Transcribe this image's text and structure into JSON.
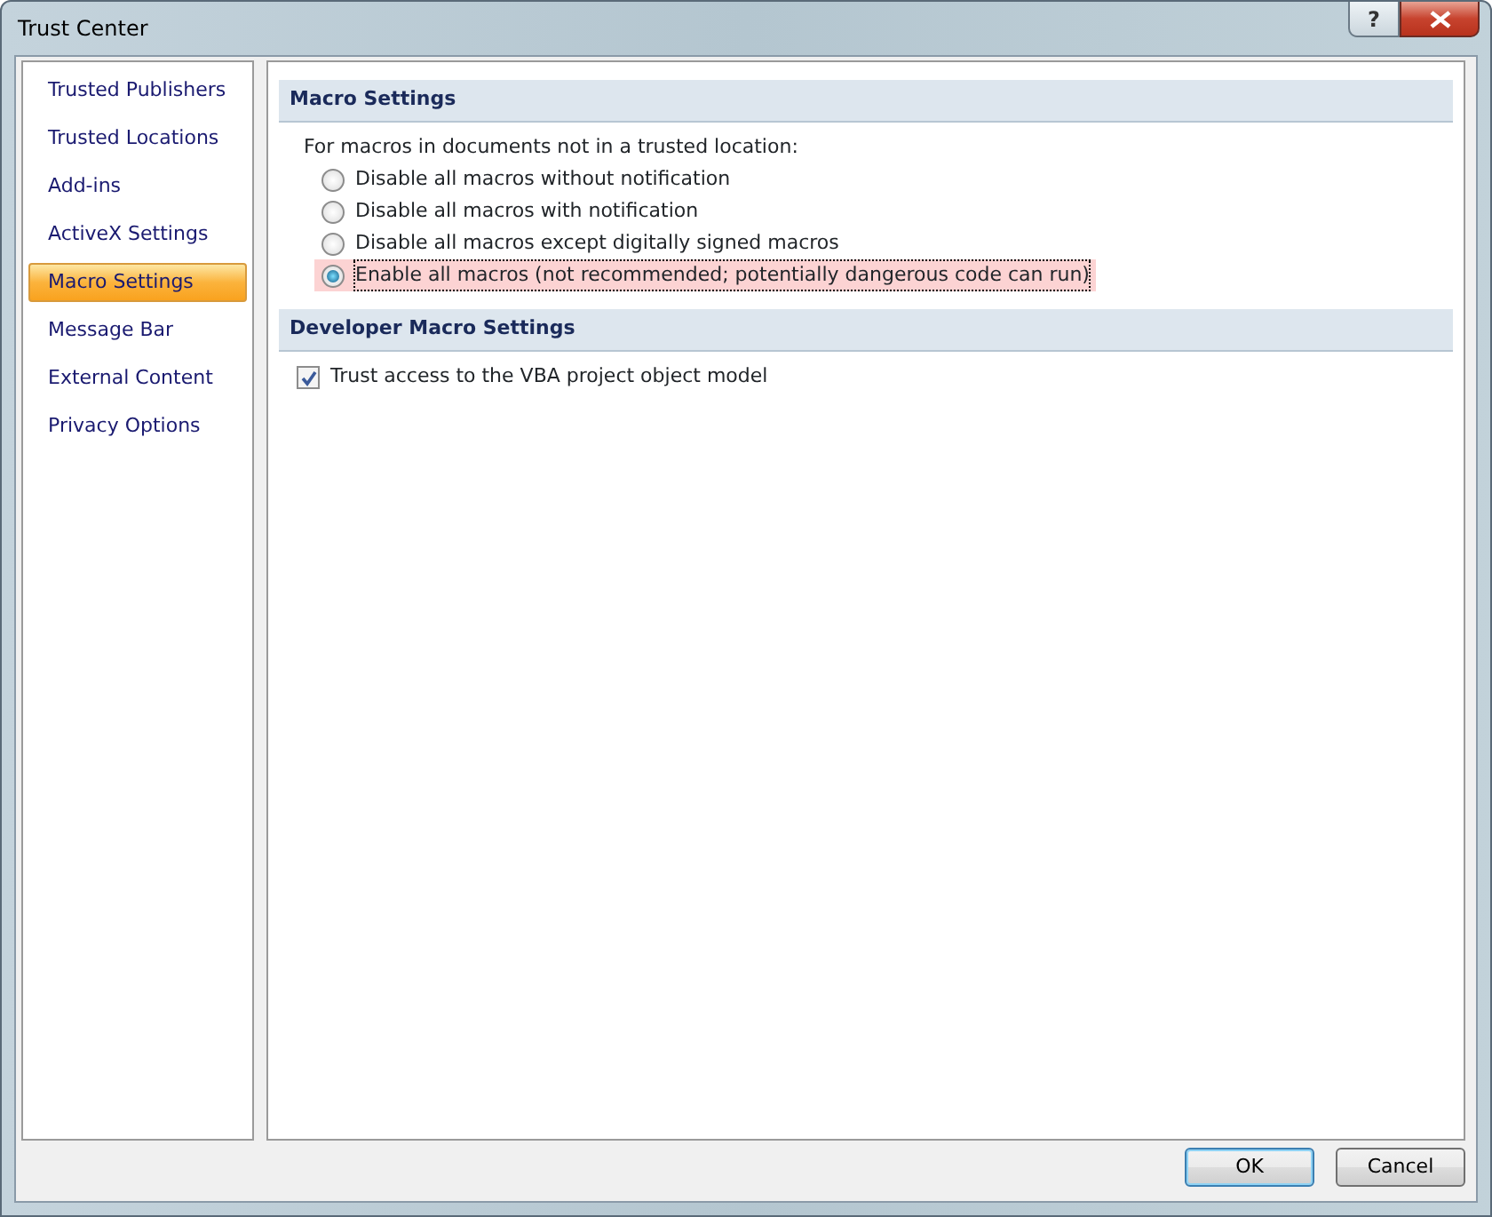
{
  "window": {
    "title": "Trust Center",
    "help_button": "?"
  },
  "sidebar": {
    "items": [
      {
        "label": "Trusted Publishers",
        "selected": false
      },
      {
        "label": "Trusted Locations",
        "selected": false
      },
      {
        "label": "Add-ins",
        "selected": false
      },
      {
        "label": "ActiveX Settings",
        "selected": false
      },
      {
        "label": "Macro Settings",
        "selected": true
      },
      {
        "label": "Message Bar",
        "selected": false
      },
      {
        "label": "External Content",
        "selected": false
      },
      {
        "label": "Privacy Options",
        "selected": false
      }
    ]
  },
  "sections": [
    {
      "title": "Macro Settings",
      "intro": "For macros in documents not in a trusted location:",
      "options": [
        {
          "kind": "radio",
          "label": "Disable all macros without notification",
          "selected": false
        },
        {
          "kind": "radio",
          "label": "Disable all macros with notification",
          "selected": false
        },
        {
          "kind": "radio",
          "label": "Disable all macros except digitally signed macros",
          "selected": false
        },
        {
          "kind": "radio",
          "label": "Enable all macros (not recommended; potentially dangerous code can run)",
          "selected": true
        }
      ]
    },
    {
      "title": "Developer Macro Settings",
      "options": [
        {
          "kind": "checkbox",
          "label": "Trust access to the VBA project object model",
          "checked": true
        }
      ]
    }
  ],
  "buttons": [
    {
      "label": "OK",
      "default": true
    },
    {
      "label": "Cancel",
      "default": false
    }
  ]
}
